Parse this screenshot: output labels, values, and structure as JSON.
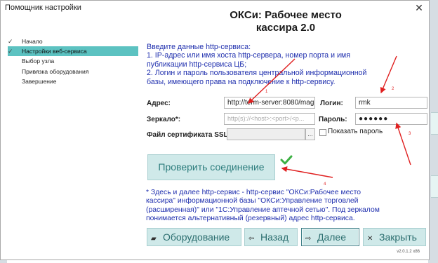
{
  "window": {
    "title": "Помощник настройки",
    "close_label": "✕"
  },
  "heading": {
    "line1": "ОКСи: Рабочее место",
    "line2": "кассира 2.0"
  },
  "sidebar": {
    "items": [
      {
        "label": "Начало",
        "mark": "✓"
      },
      {
        "label": "Настройки веб-сервиса",
        "mark": "✓"
      },
      {
        "label": "Выбор узла",
        "mark": ""
      },
      {
        "label": "Привязка оборудования",
        "mark": ""
      },
      {
        "label": "Завершение",
        "mark": ""
      }
    ]
  },
  "instructions": [
    "Введите данные http-сервиса:",
    "1. IP-адрес или имя хоста http-сервера, номер порта и имя",
    "публикации http-сервиса ЦБ;",
    "2. Логин и пароль пользователя центральной информационной",
    "базы, имеющего права на подключение к http-сервису."
  ],
  "form": {
    "address_label": "Адрес:",
    "address_value": "http://term-server:8080/mag",
    "mirror_label": "Зеркало*:",
    "mirror_placeholder": "http(s)://<host>:<port>/<p...",
    "ssl_label": "Файл сертификата SSL:",
    "ssl_value": "",
    "ssl_button": "...",
    "login_label": "Логин:",
    "login_value": "rmk",
    "password_label": "Пароль:",
    "password_value": "●●●●●●",
    "show_password_label": "Показать пароль"
  },
  "verify_button": "Проверить соединение",
  "note": [
    "* Здесь и далее http-сервис - http-сервис \"ОКСи:Рабочее место",
    "кассира\" информационной базы \"ОКСи:Управление торговлей",
    "(расширенная)\" или \"1С:Управление аптечной сетью\". Под зеркалом",
    "понимается альтернативный (резервный) адрес http-сервиса."
  ],
  "buttons": {
    "equipment": "Оборудование",
    "back": "Назад",
    "next": "Далее",
    "close": "Закрыть"
  },
  "icons": {
    "equipment": "printer-icon",
    "back": "back-arrow-icon",
    "next": "next-arrow-icon",
    "close": "close-icon",
    "verify_ok": "green-check-icon"
  },
  "version": "v2.0.1.2 x86",
  "annotations": [
    "1",
    "2",
    "3",
    "4"
  ],
  "colors": {
    "accent": "#5cc2c1",
    "button_bg": "#cfe9e9",
    "button_text": "#2d6f70",
    "instruction_text": "#1f2fae",
    "annotation": "#e02020",
    "ok_check": "#3cb043"
  }
}
